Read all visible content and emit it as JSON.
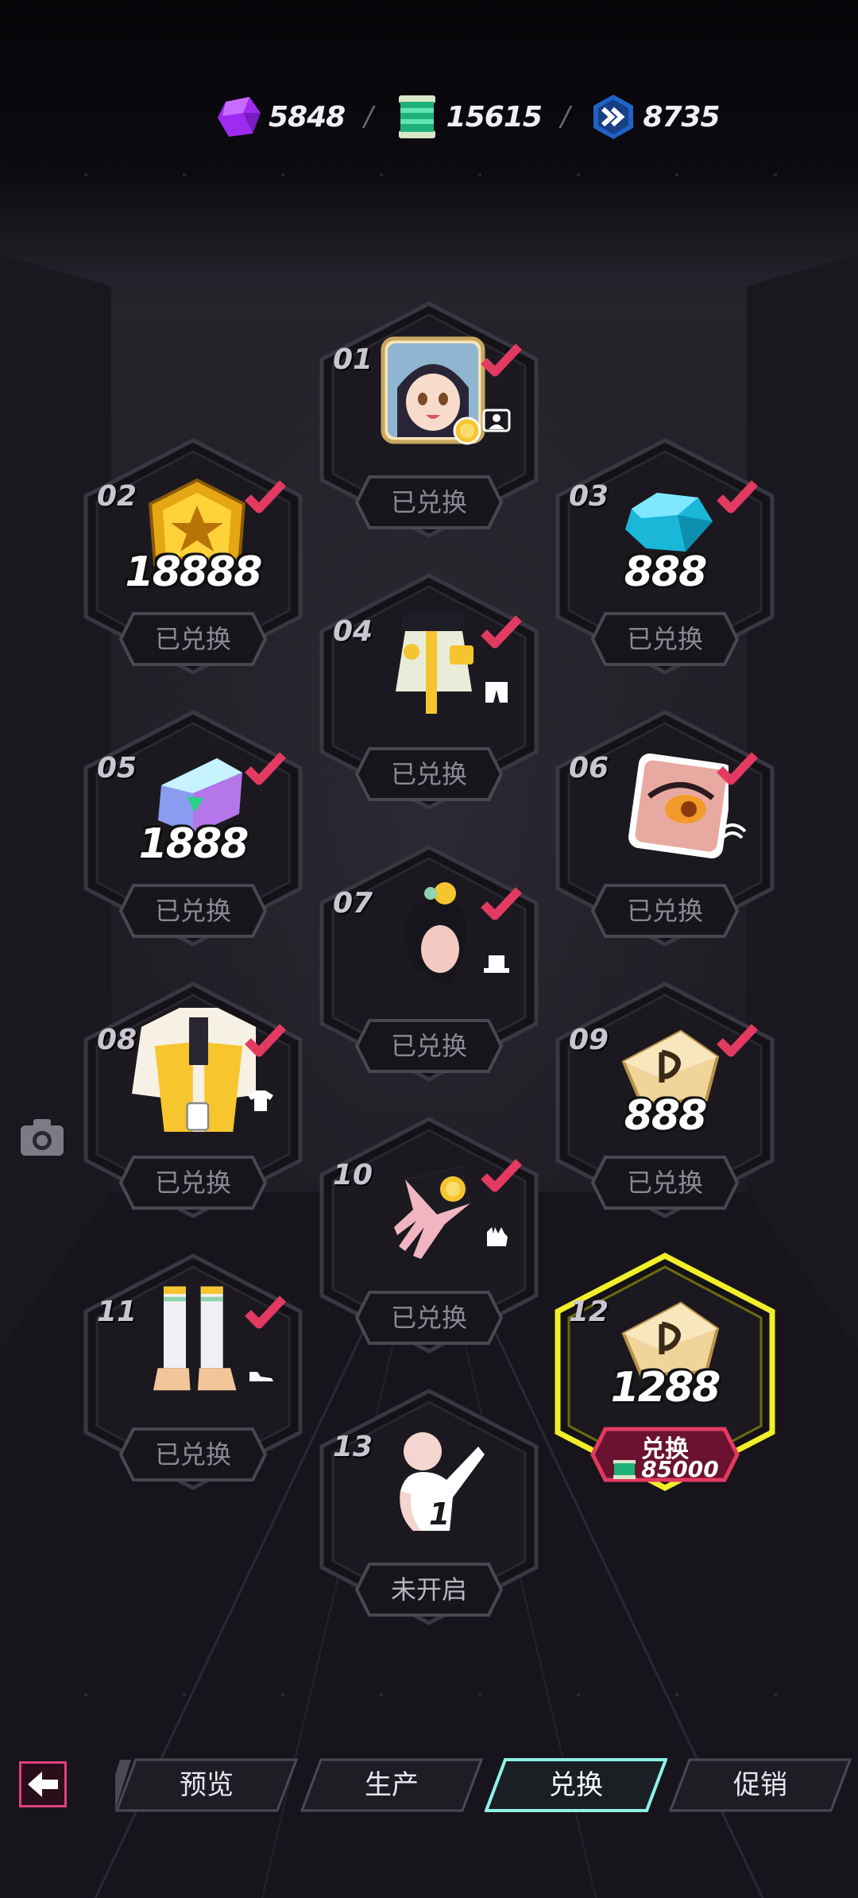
{
  "currencies": [
    {
      "icon": "purple-gem-icon",
      "value": "5848",
      "color": "#b13dff"
    },
    {
      "icon": "green-ticket-icon",
      "value": "15615",
      "color": "#2fcf8e"
    },
    {
      "icon": "blue-chevron-coin-icon",
      "value": "8735",
      "color": "#2d7fe0"
    }
  ],
  "separator": "/",
  "tiles": [
    {
      "num": "01",
      "item": "avatar-portrait-icon",
      "qty": "",
      "type": "portrait-type-icon",
      "claimed": true,
      "button": "已兑换"
    },
    {
      "num": "02",
      "item": "gold-badge-icon",
      "qty": "18888",
      "type": "",
      "claimed": true,
      "button": "已兑换"
    },
    {
      "num": "03",
      "item": "blue-diamond-icon",
      "qty": "888",
      "type": "",
      "claimed": true,
      "button": "已兑换"
    },
    {
      "num": "04",
      "item": "skirt-outfit-icon",
      "qty": "",
      "type": "bottoms-type-icon",
      "claimed": true,
      "button": "已兑换"
    },
    {
      "num": "05",
      "item": "holo-crystal-icon",
      "qty": "1888",
      "type": "",
      "claimed": true,
      "button": "已兑换"
    },
    {
      "num": "06",
      "item": "eye-makeup-icon",
      "qty": "",
      "type": "eye-type-icon",
      "claimed": true,
      "button": "已兑换"
    },
    {
      "num": "07",
      "item": "hairstyle-icon",
      "qty": "",
      "type": "hat-type-icon",
      "claimed": true,
      "button": "已兑换"
    },
    {
      "num": "08",
      "item": "jacket-outfit-icon",
      "qty": "",
      "type": "top-type-icon",
      "claimed": true,
      "button": "已兑换"
    },
    {
      "num": "09",
      "item": "gold-plate-icon",
      "qty": "888",
      "type": "",
      "claimed": true,
      "button": "已兑换"
    },
    {
      "num": "10",
      "item": "glove-icon",
      "qty": "",
      "type": "glove-type-icon",
      "claimed": true,
      "button": "已兑换"
    },
    {
      "num": "11",
      "item": "leg-warmers-icon",
      "qty": "",
      "type": "shoe-type-icon",
      "claimed": true,
      "button": "已兑换"
    },
    {
      "num": "12",
      "item": "gold-plate-icon",
      "qty": "1288",
      "type": "",
      "claimed": false,
      "active": true,
      "button": "兑换",
      "cost": "85000"
    },
    {
      "num": "13",
      "item": "emote-pose-icon",
      "qty": "",
      "type": "",
      "claimed": false,
      "button": "未开启"
    }
  ],
  "nav": {
    "tabs": [
      "预览",
      "生产",
      "兑换",
      "促销"
    ],
    "active_tab": "兑换",
    "accent": "#e0417a",
    "active_color": "#8ff1e6"
  }
}
